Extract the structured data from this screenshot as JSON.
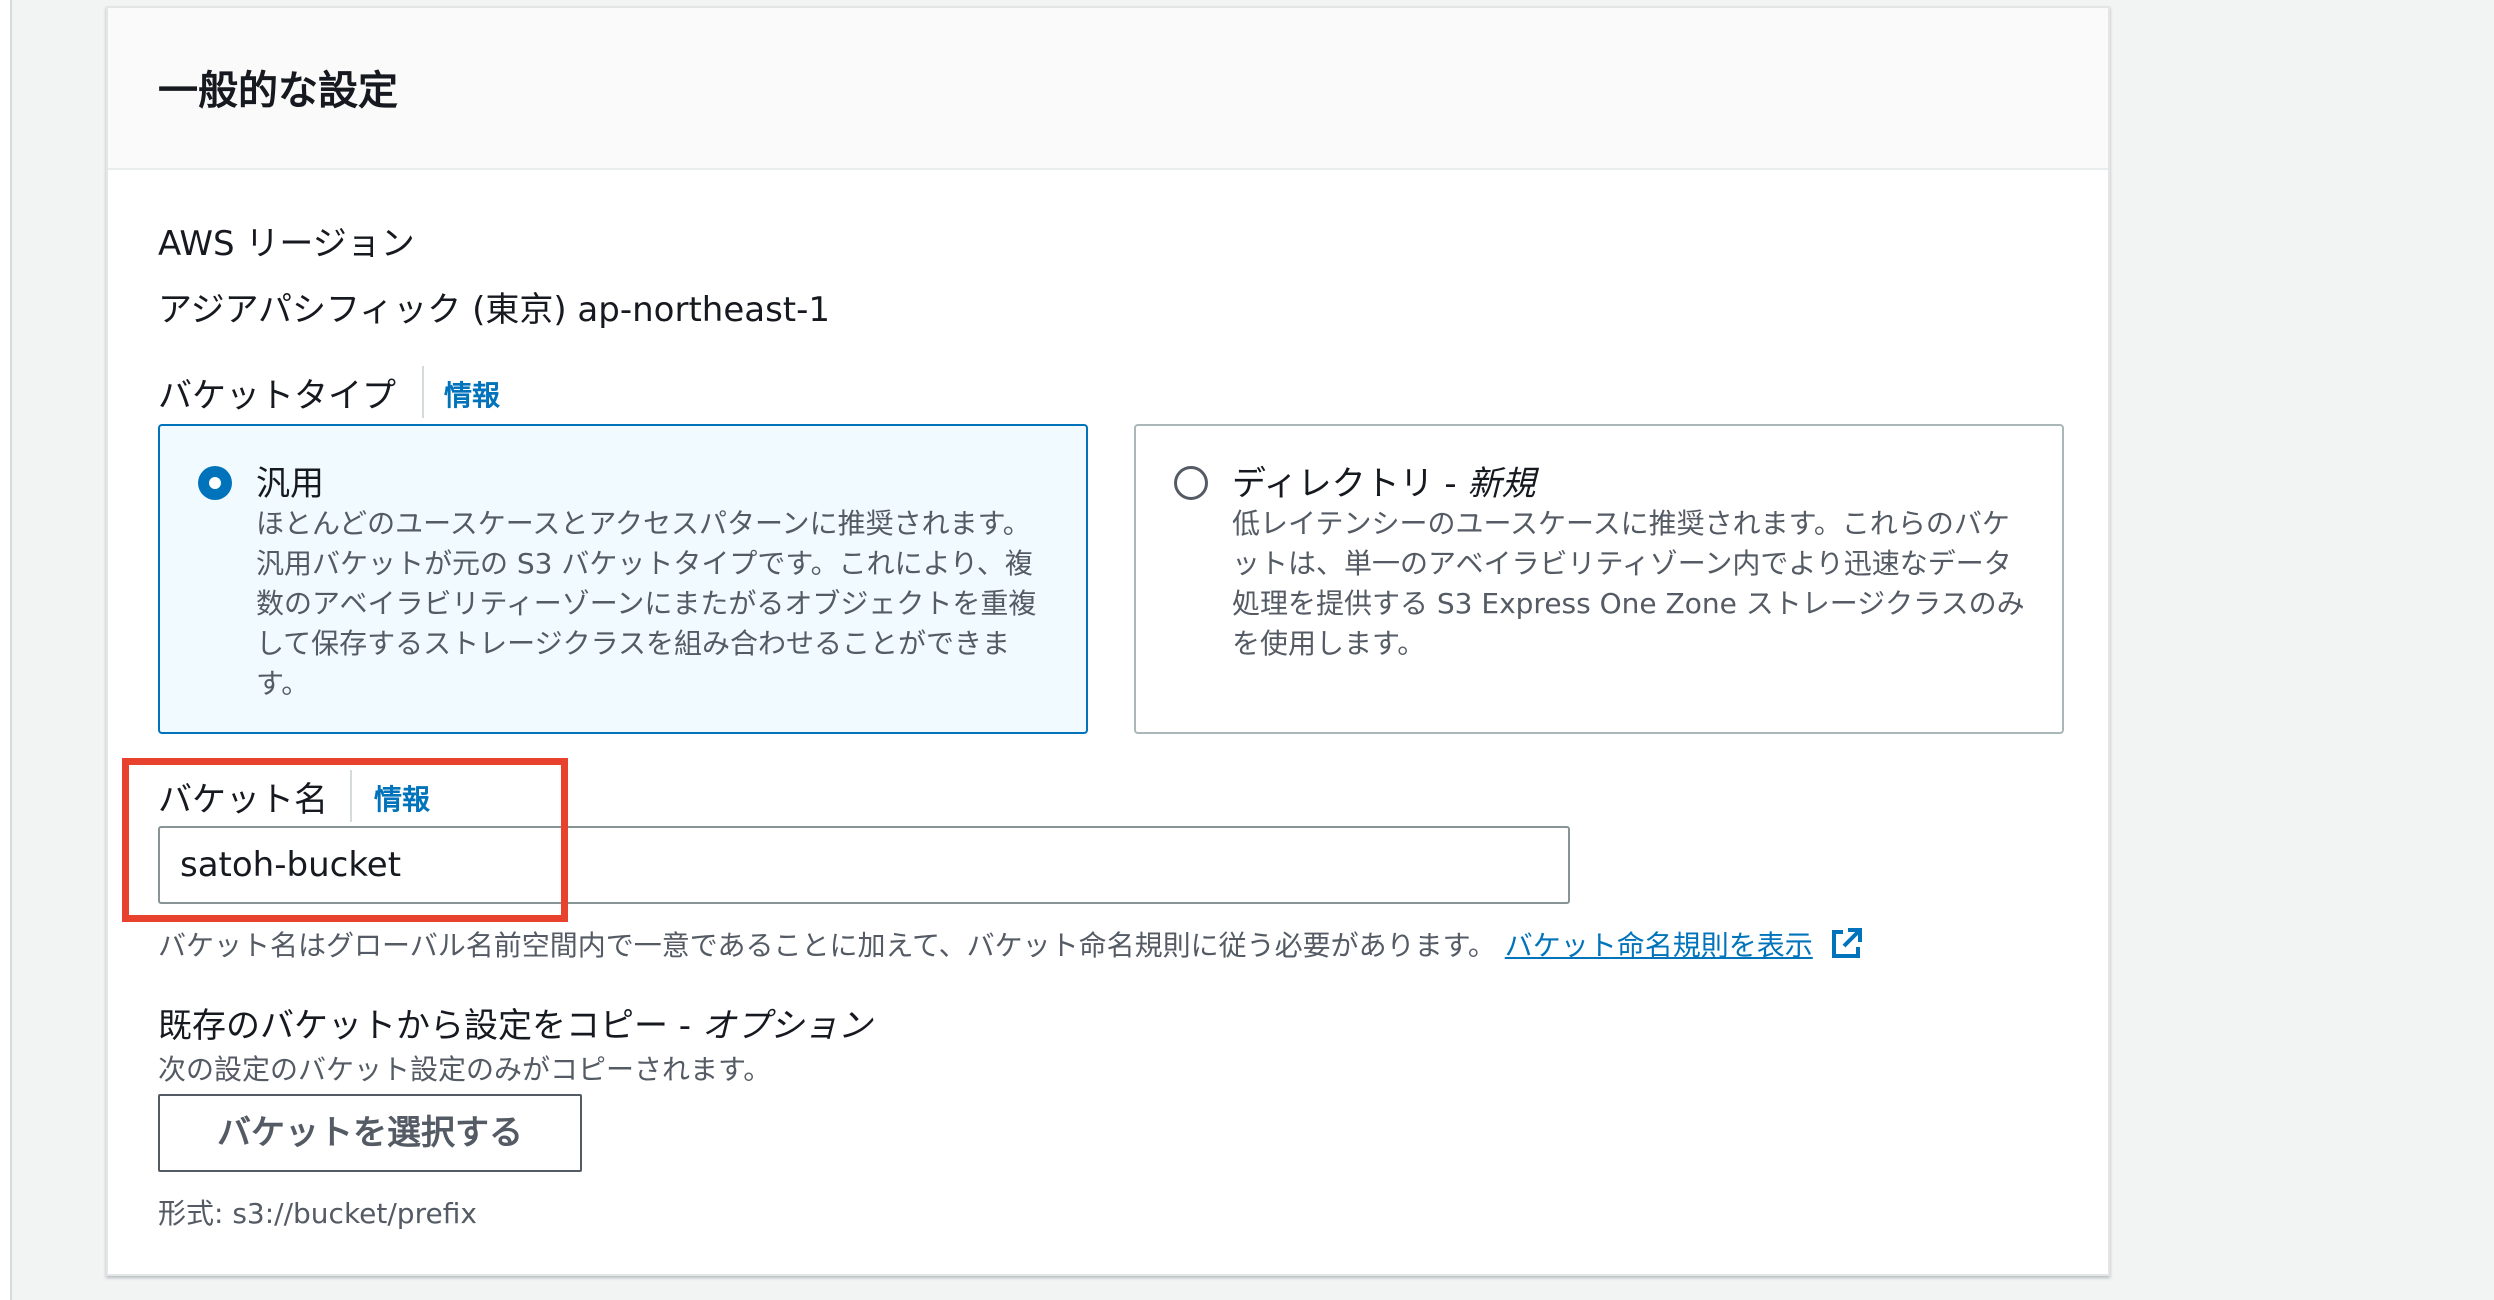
{
  "panel": {
    "title": "一般的な設定"
  },
  "region": {
    "label": "AWS リージョン",
    "value": "アジアパシフィック (東京) ap-northeast-1"
  },
  "bucket_type": {
    "label": "バケットタイプ",
    "info": "情報",
    "options": [
      {
        "title": "汎用",
        "selected": true,
        "description": "ほとんどのユースケースとアクセスパターンに推奨されます。汎用バケットが元の S3 バケットタイプです。これにより、複数のアベイラビリティーゾーンにまたがるオブジェクトを重複して保存するストレージクラスを組み合わせることができます。"
      },
      {
        "title": "ディレクトリ - ",
        "title_suffix": "新規",
        "selected": false,
        "description": "低レイテンシーのユースケースに推奨されます。これらのバケットは、単一のアベイラビリティゾーン内でより迅速なデータ処理を提供する S3 Express One Zone ストレージクラスのみを使用します。"
      }
    ]
  },
  "bucket_name": {
    "label": "バケット名",
    "info": "情報",
    "value": "satoh-bucket",
    "hint": "バケット名はグローバル名前空間内で一意であることに加えて、バケット命名規則に従う必要があります。",
    "link": "バケット命名規則を表示"
  },
  "copy_settings": {
    "label": "既存のバケットから設定をコピー - ",
    "label_suffix": "オプション",
    "description": "次の設定のバケット設定のみがコピーされます。",
    "button": "バケットを選択する",
    "format": "形式: s3://bucket/prefix"
  },
  "colors": {
    "accent": "#0073bb",
    "highlight": "#e8412e"
  },
  "icons": {
    "external_link": "external-link-icon"
  }
}
